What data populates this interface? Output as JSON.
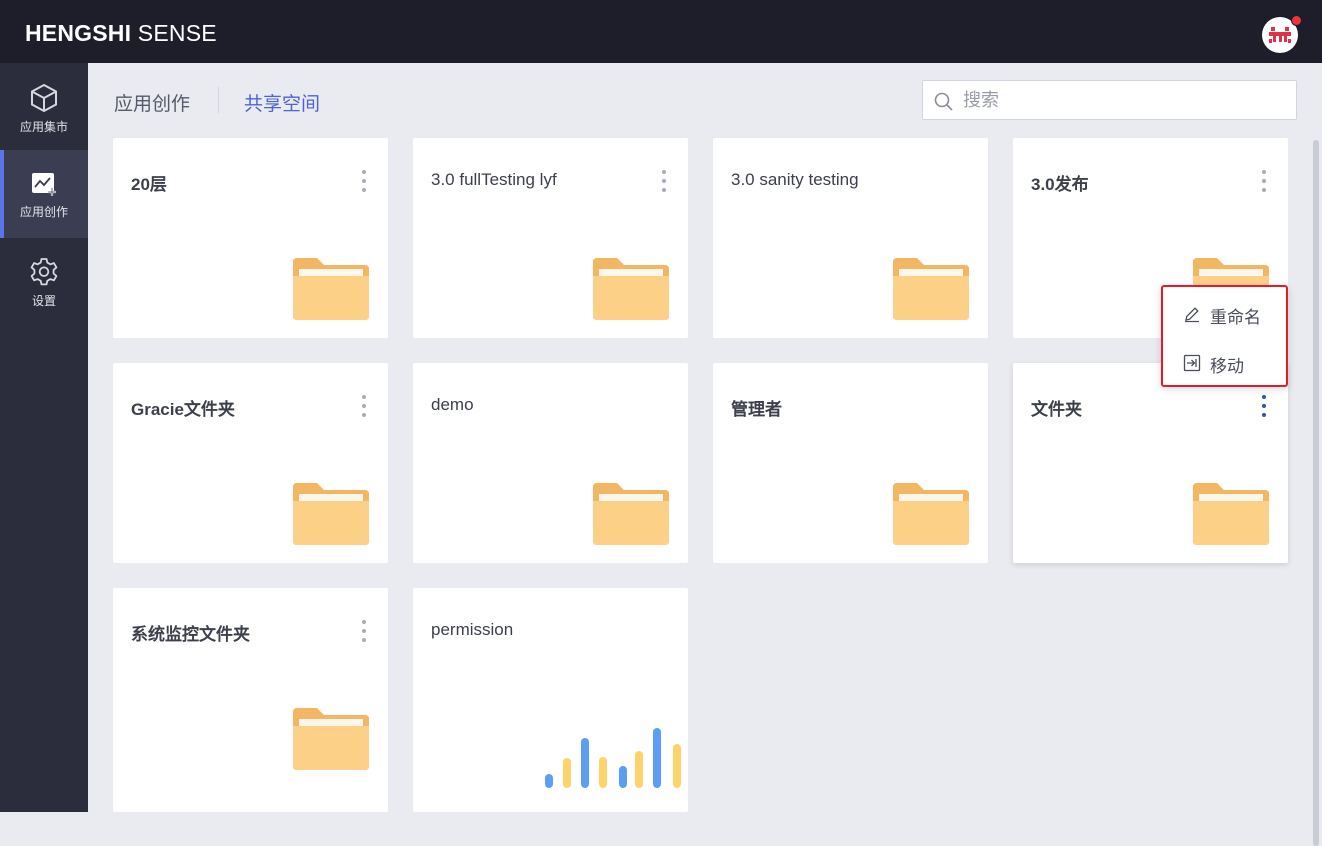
{
  "app": {
    "brand_bold": "HENGSHI",
    "brand_light": "SENSE"
  },
  "sidebar": {
    "items": [
      {
        "label": "应用集市",
        "icon": "cube-icon",
        "active": false
      },
      {
        "label": "应用创作",
        "icon": "chart-add-icon",
        "active": true
      },
      {
        "label": "设置",
        "icon": "gear-icon",
        "active": false
      }
    ]
  },
  "tabs": [
    {
      "label": "应用创作",
      "active": false
    },
    {
      "label": "共享空间",
      "active": true
    }
  ],
  "search": {
    "placeholder": "搜索",
    "value": ""
  },
  "cards": [
    {
      "title": "20层",
      "type": "folder"
    },
    {
      "title": "3.0 fullTesting lyf",
      "type": "folder"
    },
    {
      "title": "3.0 sanity testing",
      "type": "folder"
    },
    {
      "title": "3.0发布",
      "type": "folder"
    },
    {
      "title": "Gracie文件夹",
      "type": "folder"
    },
    {
      "title": "demo",
      "type": "folder"
    },
    {
      "title": "管理者",
      "type": "folder"
    },
    {
      "title": "文件夹",
      "type": "folder"
    },
    {
      "title": "系统监控文件夹",
      "type": "folder"
    },
    {
      "title": "permission",
      "type": "app"
    }
  ],
  "context_menu": {
    "items": [
      {
        "label": "重命名",
        "icon": "pencil-icon"
      },
      {
        "label": "移动",
        "icon": "move-icon"
      }
    ]
  },
  "colors": {
    "accent": "#4a64d8",
    "highlight_border": "#e8192c",
    "folder": "#f9c87c",
    "bar_blue": "#5b9ef4",
    "bar_yellow": "#ffd36b"
  }
}
